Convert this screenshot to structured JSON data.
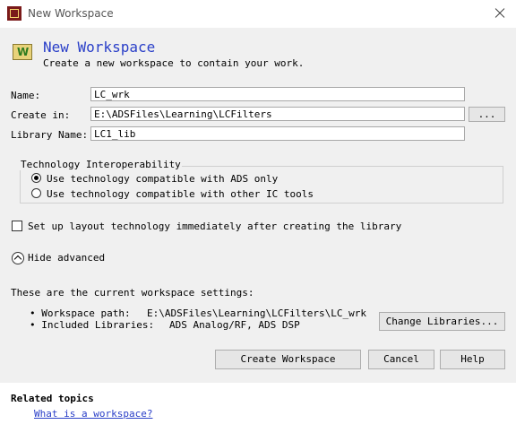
{
  "window": {
    "title": "New Workspace"
  },
  "header": {
    "title": "New Workspace",
    "subtitle": "Create a new workspace to contain your work."
  },
  "form": {
    "name_label": "Name:",
    "name_value": "LC_wrk",
    "create_in_label": "Create in:",
    "create_in_value": "E:\\ADSFiles\\Learning\\LCFilters",
    "browse_label": "...",
    "library_label": "Library Name:",
    "library_value": "LC1_lib"
  },
  "interop": {
    "title": "Technology Interoperability",
    "options": [
      {
        "label": "Use technology compatible with ADS only",
        "selected": true
      },
      {
        "label": "Use technology compatible with other IC tools",
        "selected": false
      }
    ]
  },
  "setup_layout": {
    "label": "Set up layout technology immediately after creating the library",
    "checked": false
  },
  "advanced": {
    "label": "Hide advanced"
  },
  "settings": {
    "intro": "These are the current workspace settings:",
    "path_label": "• Workspace path:",
    "path_value": "E:\\ADSFiles\\Learning\\LCFilters\\LC_wrk",
    "libs_label": "• Included Libraries:",
    "libs_value": "ADS Analog/RF, ADS DSP",
    "change_button": "Change Libraries..."
  },
  "buttons": {
    "create": "Create Workspace",
    "cancel": "Cancel",
    "help": "Help"
  },
  "related": {
    "title": "Related topics",
    "link": "What is a workspace?"
  }
}
